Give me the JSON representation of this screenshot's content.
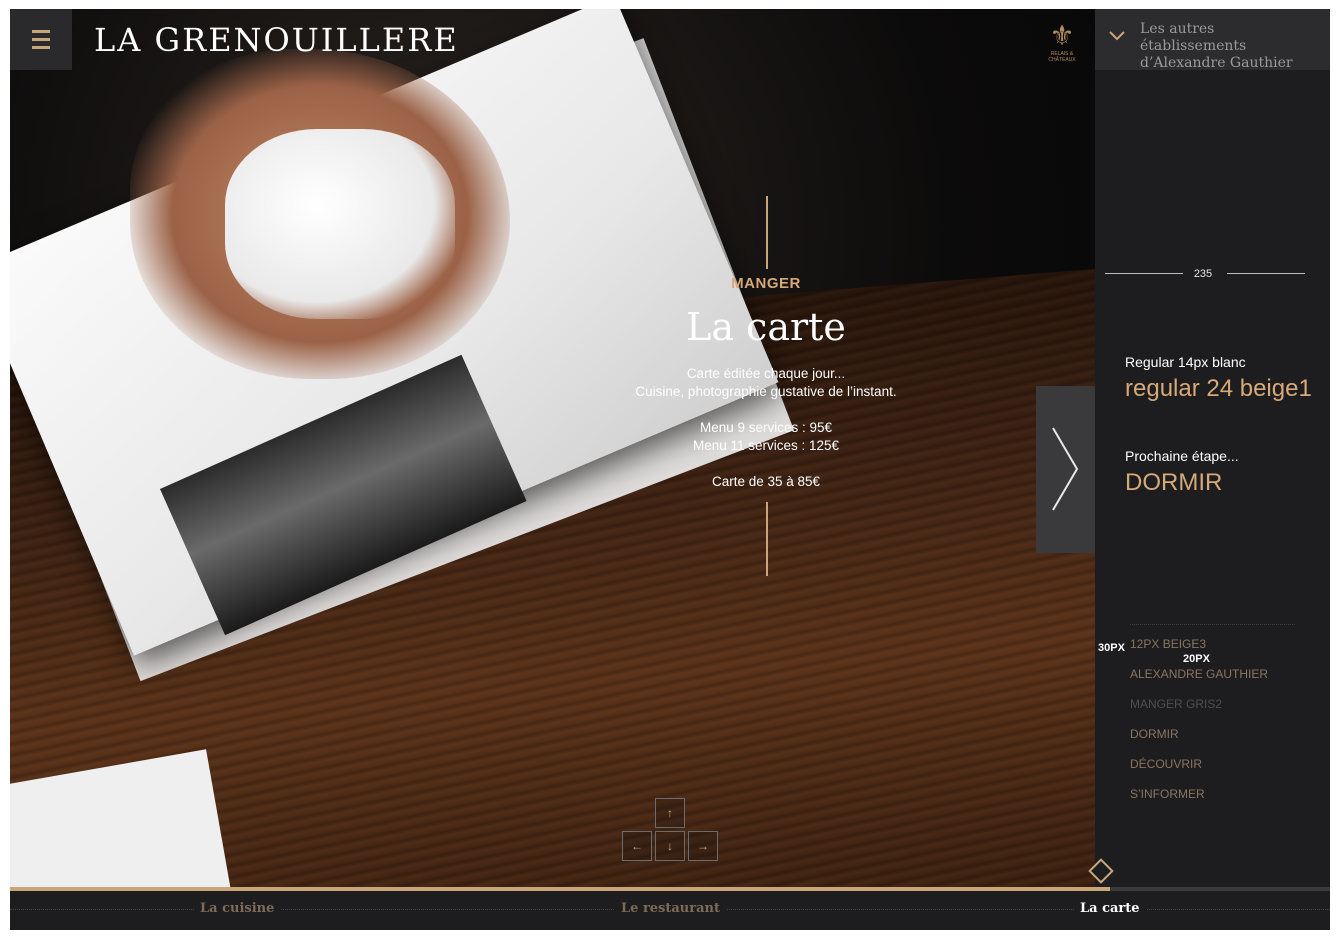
{
  "header": {
    "logo_text": "LA GRENOUILLERE",
    "badge_text": "RELAIS & CHÂTEAUX",
    "establishments_text": "Les autres établissements d’Alexandre Gauthier"
  },
  "content": {
    "eyebrow": "MANGER",
    "title": "La carte",
    "description_lines": [
      "Carte éditée chaque jour...",
      "Cuisine, photographie gustative de l’instant."
    ],
    "menu_lines": [
      "Menu 9 services : 95€",
      "Menu 11 services : 125€"
    ],
    "carte_line": "Carte de 35 à 85€"
  },
  "panel": {
    "spec_width": "235",
    "regular_small": "Regular 14px blanc",
    "regular_big": "regular 24 beige1",
    "next_label": "Prochaine étape...",
    "next_value": "DORMIR",
    "annotation_30": "30PX",
    "annotation_20": "20PX",
    "nav": [
      {
        "label": "12PX BEIGE3",
        "color": "#8a7560"
      },
      {
        "label": "ALEXANDRE GAUTHIER",
        "color": "#8a7560"
      },
      {
        "label": "MANGER GRIS2",
        "color": "#4e4e4e"
      },
      {
        "label": "DORMIR",
        "color": "#8a7560"
      },
      {
        "label": "DÉCOUVRIR",
        "color": "#8a7560"
      },
      {
        "label": "S’INFORMER",
        "color": "#8a7560"
      }
    ]
  },
  "keys": {
    "up": "↑",
    "left": "←",
    "down": "↓",
    "right": "→"
  },
  "progress": {
    "fraction": 0.833
  },
  "bottom_nav": [
    {
      "label": "La cuisine",
      "color": "#7d6b57"
    },
    {
      "label": "Le restaurant",
      "color": "#7d6b57"
    },
    {
      "label": "La carte",
      "color": "#ffffff"
    }
  ],
  "colors": {
    "beige": "#c9a57a",
    "panel_bg": "#1d1d1f"
  }
}
